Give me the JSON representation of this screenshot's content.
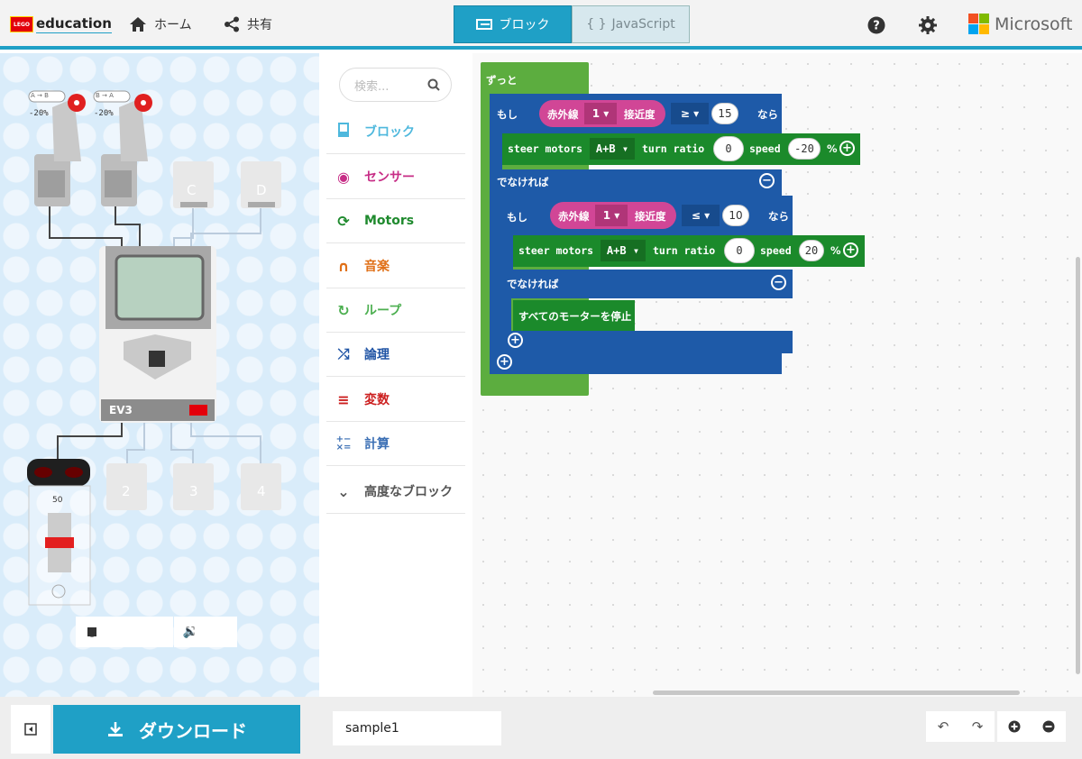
{
  "header": {
    "logo_badge": "LEGO",
    "logo_text": "education",
    "home_label": "ホーム",
    "share_label": "共有",
    "blocks_tab_label": "ブロック",
    "js_tab_label": "JavaScript",
    "js_tab_braces": "{ }",
    "ms_label": "Microsoft",
    "ms_colors": [
      "#f25022",
      "#7fba00",
      "#00a4ef",
      "#ffb900"
    ]
  },
  "simulator": {
    "motor_a_label": "-20%",
    "motor_b_label": "-20%",
    "motor_a_tag": "A → B",
    "motor_b_tag": "B → A",
    "ports_top": [
      "C",
      "D"
    ],
    "ports_bottom": [
      "2",
      "3",
      "4"
    ],
    "brick_label": "EV3",
    "ir_value": "50",
    "controls": [
      "stop",
      "restart",
      "slow-motion",
      "sound",
      "fullscreen"
    ]
  },
  "toolbox": {
    "search_placeholder": "検索...",
    "categories": [
      {
        "label": "ブロック",
        "color": "#4eb8dd"
      },
      {
        "label": "センサー",
        "color": "#c72d86"
      },
      {
        "label": "Motors",
        "color": "#1f8a2e"
      },
      {
        "label": "音楽",
        "color": "#e07018"
      },
      {
        "label": "ループ",
        "color": "#4caf50"
      },
      {
        "label": "論理",
        "color": "#2155a5"
      },
      {
        "label": "変数",
        "color": "#cc1f1f"
      },
      {
        "label": "計算",
        "color": "#3b6fb4"
      },
      {
        "label": "高度なブロック",
        "color": "#555555"
      }
    ]
  },
  "workspace": {
    "forever": "ずっと",
    "if1": {
      "kw": "もし",
      "sensor": "赤外線",
      "port": "1",
      "mode": "接近度",
      "op": "≥",
      "value": "15",
      "then": "なら"
    },
    "steer1": {
      "label": "steer motors",
      "ports": "A+B",
      "ratio_label": "turn ratio",
      "ratio": "0",
      "speed_label": "speed",
      "speed": "-20",
      "unit": "%"
    },
    "else1": "でなければ",
    "if2": {
      "kw": "もし",
      "sensor": "赤外線",
      "port": "1",
      "mode": "接近度",
      "op": "≤",
      "value": "10",
      "then": "なら"
    },
    "steer2": {
      "label": "steer motors",
      "ports": "A+B",
      "ratio_label": "turn ratio",
      "ratio": "0",
      "speed_label": "speed",
      "speed": "20",
      "unit": "%"
    },
    "else2": "でなければ",
    "stop_all": "すべてのモーターを停止"
  },
  "bottom": {
    "download_label": "ダウンロード",
    "project_name": "sample1"
  },
  "colors": {
    "accent": "#1fa0c6",
    "logic": "#1e5aa8",
    "loop": "#5cad3f",
    "motors": "#1b8a2b",
    "sensor": "#d14696"
  }
}
